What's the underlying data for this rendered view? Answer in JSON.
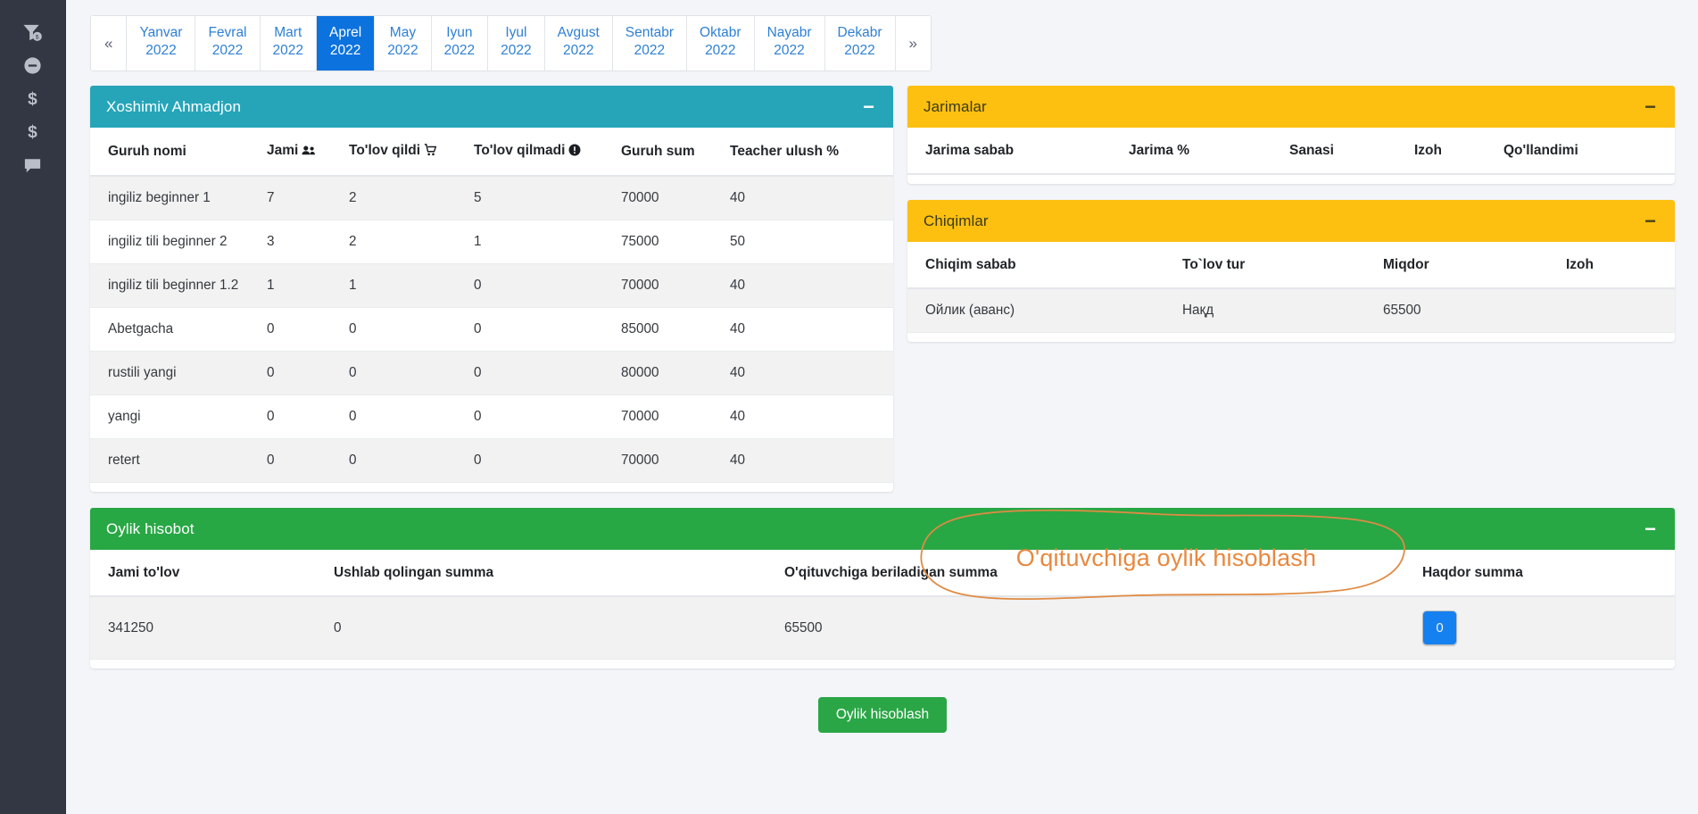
{
  "sidebar": {
    "items": [
      {
        "name": "funnel-dollar-icon",
        "label": "Filtr (pul)"
      },
      {
        "name": "minus-circle-icon",
        "label": "Chiqim"
      },
      {
        "name": "dollar-sign-icon",
        "label": "To'lov"
      },
      {
        "name": "dollar-sign-alt-icon",
        "label": "Oylik"
      },
      {
        "name": "comment-icon",
        "label": "Izohlar"
      }
    ]
  },
  "months": {
    "prev_label": "«",
    "next_label": "»",
    "year": "2022",
    "active": "Aprel",
    "items": [
      {
        "name": "Yanvar",
        "year": "2022"
      },
      {
        "name": "Fevral",
        "year": "2022"
      },
      {
        "name": "Mart",
        "year": "2022"
      },
      {
        "name": "Aprel",
        "year": "2022"
      },
      {
        "name": "May",
        "year": "2022"
      },
      {
        "name": "Iyun",
        "year": "2022"
      },
      {
        "name": "Iyul",
        "year": "2022"
      },
      {
        "name": "Avgust",
        "year": "2022"
      },
      {
        "name": "Sentabr",
        "year": "2022"
      },
      {
        "name": "Oktabr",
        "year": "2022"
      },
      {
        "name": "Nayabr",
        "year": "2022"
      },
      {
        "name": "Dekabr",
        "year": "2022"
      }
    ]
  },
  "teacher_card": {
    "title": "Xoshimiv Ahmadjon",
    "collapse_label": "−",
    "columns": [
      "Guruh nomi",
      "Jami",
      "To'lov qildi",
      "To'lov qilmadi",
      "Guruh sum",
      "Teacher ulush %"
    ],
    "column_icons": [
      "",
      "users-icon",
      "cart-icon",
      "exclamation-circle-icon",
      "",
      ""
    ],
    "rows": [
      {
        "group": "ingiliz beginner 1",
        "jami": "7",
        "paid": "2",
        "unpaid": "5",
        "sum": "70000",
        "share": "40"
      },
      {
        "group": "ingiliz tili beginner 2",
        "jami": "3",
        "paid": "2",
        "unpaid": "1",
        "sum": "75000",
        "share": "50"
      },
      {
        "group": "ingiliz tili beginner 1.2",
        "jami": "1",
        "paid": "1",
        "unpaid": "0",
        "sum": "70000",
        "share": "40"
      },
      {
        "group": "Abetgacha",
        "jami": "0",
        "paid": "0",
        "unpaid": "0",
        "sum": "85000",
        "share": "40"
      },
      {
        "group": "rustili yangi",
        "jami": "0",
        "paid": "0",
        "unpaid": "0",
        "sum": "80000",
        "share": "40"
      },
      {
        "group": "yangi",
        "jami": "0",
        "paid": "0",
        "unpaid": "0",
        "sum": "70000",
        "share": "40"
      },
      {
        "group": "retert",
        "jami": "0",
        "paid": "0",
        "unpaid": "0",
        "sum": "70000",
        "share": "40"
      }
    ]
  },
  "jarimalar_card": {
    "title": "Jarimalar",
    "collapse_label": "−",
    "columns": [
      "Jarima sabab",
      "Jarima %",
      "Sanasi",
      "Izoh",
      "Qo'llandimi"
    ],
    "rows": []
  },
  "chiqimlar_card": {
    "title": "Chiqimlar",
    "collapse_label": "−",
    "columns": [
      "Chiqim sabab",
      "To`lov tur",
      "Miqdor",
      "Izoh"
    ],
    "rows": [
      {
        "reason": "Ойлик (аванс)",
        "type": "Нақд",
        "amount": "65500",
        "note": ""
      }
    ]
  },
  "annotation": {
    "text": "O'qituvchiga oylik hisoblash",
    "color": "#e8883f"
  },
  "report_card": {
    "title": "Oylik hisobot",
    "collapse_label": "−",
    "columns": [
      "Jami to'lov",
      "Ushlab qolingan summa",
      "O'qituvchiga beriladigan summa",
      "Haqdor summa"
    ],
    "rows": [
      {
        "total": "341250",
        "withheld": "0",
        "payable": "65500",
        "haqdor": "0"
      }
    ]
  },
  "footer": {
    "calc_button": "Oylik hisoblash"
  },
  "colors": {
    "teal": "#26a5b9",
    "yellow": "#fdc010",
    "green": "#28a745",
    "blue": "#0c72de",
    "badge_blue": "#1580ef",
    "sidebar": "#323743",
    "page_bg": "#f4f5f9"
  }
}
